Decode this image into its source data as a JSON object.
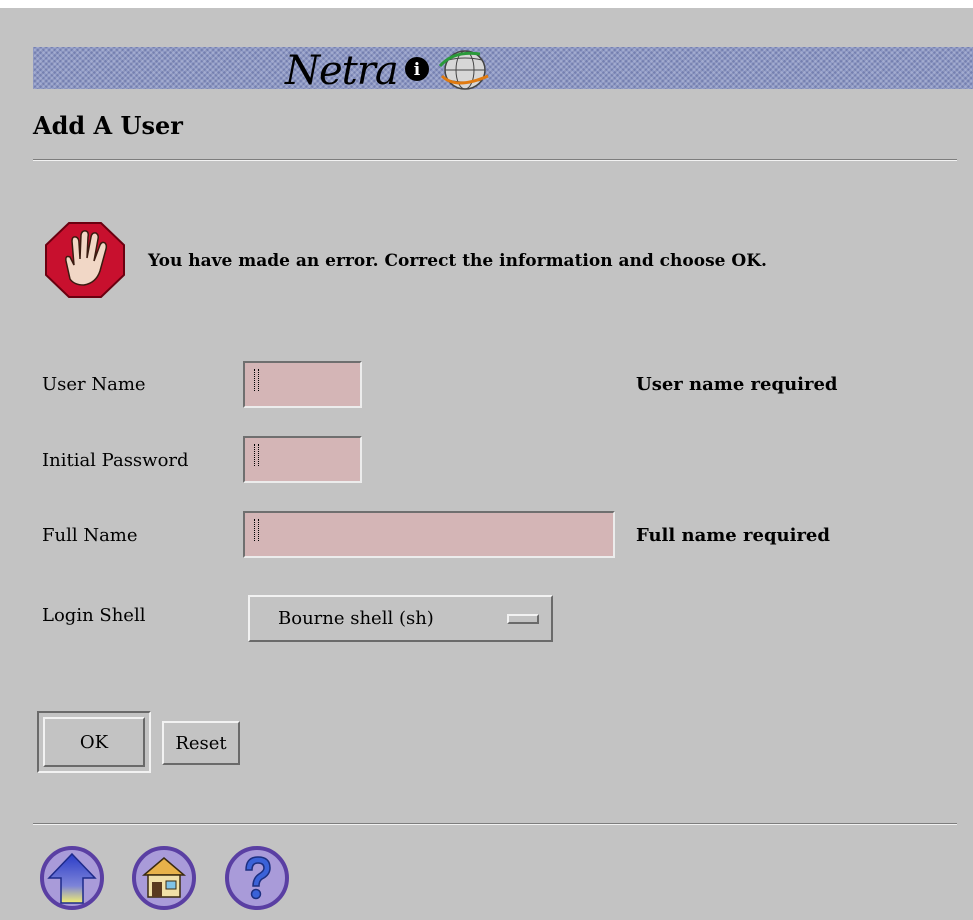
{
  "brand": {
    "name": "Netra",
    "info_glyph": "i"
  },
  "page": {
    "title": "Add A User"
  },
  "error": {
    "message": "You have made an error. Correct the information and choose OK."
  },
  "form": {
    "user_name": {
      "label": "User Name",
      "value": "",
      "error": "User name required"
    },
    "initial_password": {
      "label": "Initial Password",
      "value": ""
    },
    "full_name": {
      "label": "Full Name",
      "value": "",
      "error": "Full name required"
    },
    "login_shell": {
      "label": "Login Shell",
      "selected": "Bourne shell (sh)"
    }
  },
  "buttons": {
    "ok": "OK",
    "reset": "Reset"
  },
  "nav_icons": [
    "up-arrow-icon",
    "home-icon",
    "help-icon"
  ],
  "colors": {
    "background": "#c3c3c3",
    "banner": "#8f9ac6",
    "field_error_bg": "#d4b5b6",
    "stop_sign": "#c8102e",
    "nav_icon_ring": "#7b5cc0"
  }
}
